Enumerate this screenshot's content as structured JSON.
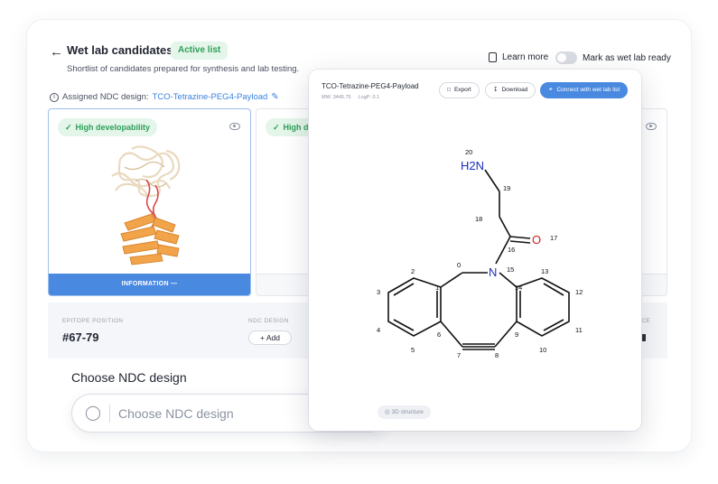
{
  "header": {
    "title": "Wet lab candidates",
    "badge": "Active list",
    "subtitle": "Shortlist of candidates prepared for synthesis and lab testing.",
    "learn_more": "Learn more",
    "toggle_label": "Mark as wet lab ready",
    "toggle_on": false
  },
  "assigned": {
    "label": "Assigned NDC design:",
    "value": "TCO-Tetrazine-PEG4-Payload"
  },
  "cards": [
    {
      "badge": "High developability",
      "button": "INFORMATION —"
    },
    {
      "badge": "High d"
    }
  ],
  "details": {
    "epitope_label": "EPITOPE POSITION",
    "epitope_value": "#67-79",
    "ndc_label": "NDC DESIGN",
    "add_label": "+ Add",
    "third_label": "NCE"
  },
  "choose": {
    "title": "Choose NDC design",
    "placeholder": "Choose NDC design"
  },
  "modal": {
    "title": "TCO-Tetrazine-PEG4-Payload",
    "mw": "MW: 3445.75",
    "logp": "LogP: 0.1",
    "export": "Export",
    "download": "Download",
    "connect": "Connect with wet lab list",
    "structure_3d": "3D structure",
    "atoms": {
      "nh2": "H2N",
      "o": "O",
      "n": "N",
      "labels": [
        "0",
        "1",
        "2",
        "3",
        "4",
        "5",
        "6",
        "7",
        "8",
        "9",
        "11",
        "12",
        "13",
        "14",
        "15",
        "16",
        "17",
        "18",
        "19",
        "20",
        "10"
      ]
    }
  },
  "colors": {
    "accent": "#4a89e0",
    "success": "#2f9e5a",
    "nitrogen": "#1a2fbf",
    "oxygen": "#d31f1f"
  }
}
